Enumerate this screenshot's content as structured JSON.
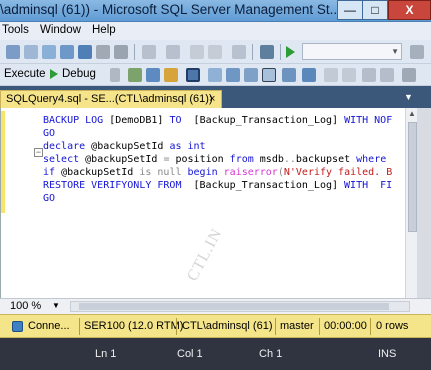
{
  "window": {
    "title": "\\adminsql (61)) - Microsoft SQL Server Management St...",
    "min_glyph": "—",
    "max_glyph": "□",
    "close_glyph": "X"
  },
  "menu": [
    "Tools",
    "Window",
    "Help"
  ],
  "toolbar2": {
    "execute_label": "Execute",
    "debug_label": "Debug",
    "execute_icon": "exclamation-icon",
    "debug_icon": "play-icon"
  },
  "tab": {
    "label": "SQLQuery4.sql - SE...(CTL\\adminsql (61))",
    "close_glyph": "×",
    "menu_glyph": "▼"
  },
  "editor": {
    "lines": [
      {
        "segments": [
          {
            "t": "BACKUP LOG ",
            "c": "kw"
          },
          {
            "t": "[DemoDB1] ",
            "c": ""
          },
          {
            "t": "TO  ",
            "c": "kw"
          },
          {
            "t": "[Backup_Transaction_Log] ",
            "c": ""
          },
          {
            "t": "WITH NOF",
            "c": "kw"
          }
        ]
      },
      {
        "segments": [
          {
            "t": "GO",
            "c": "kw"
          }
        ]
      },
      {
        "segments": [
          {
            "t": "declare ",
            "c": "kw"
          },
          {
            "t": "@backupSetId ",
            "c": ""
          },
          {
            "t": "as int",
            "c": "kw"
          }
        ]
      },
      {
        "segments": [
          {
            "t": "select ",
            "c": "kw"
          },
          {
            "t": "@backupSetId ",
            "c": ""
          },
          {
            "t": "= ",
            "c": "gray"
          },
          {
            "t": "position ",
            "c": ""
          },
          {
            "t": "from ",
            "c": "kw"
          },
          {
            "t": "msdb",
            "c": ""
          },
          {
            "t": "..",
            "c": "gray"
          },
          {
            "t": "backupset ",
            "c": ""
          },
          {
            "t": "where",
            "c": "kw"
          }
        ]
      },
      {
        "segments": [
          {
            "t": "if ",
            "c": "kw"
          },
          {
            "t": "@backupSetId ",
            "c": ""
          },
          {
            "t": "is null ",
            "c": "gray"
          },
          {
            "t": "begin ",
            "c": "kw"
          },
          {
            "t": "raiserror",
            "c": "fn"
          },
          {
            "t": "(",
            "c": "gray"
          },
          {
            "t": "N'Verify failed. B",
            "c": "str"
          }
        ]
      },
      {
        "segments": [
          {
            "t": "RESTORE VERIFYONLY FROM  ",
            "c": "kw"
          },
          {
            "t": "[Backup_Transaction_Log] ",
            "c": ""
          },
          {
            "t": "WITH  FI",
            "c": "kw"
          }
        ]
      },
      {
        "segments": [
          {
            "t": "GO",
            "c": "kw"
          }
        ]
      }
    ],
    "watermark": "CTL.IN"
  },
  "zoom": {
    "value": "100 %",
    "arrow": "▼"
  },
  "query_status": {
    "connection": "Conne...",
    "server": "SER100 (12.0 RTM)",
    "user": "CTL\\adminsql (61)",
    "database": "master",
    "elapsed": "00:00:00",
    "rows": "0 rows"
  },
  "app_status": {
    "line": "Ln 1",
    "col": "Col 1",
    "ch": "Ch 1",
    "mode": "INS"
  },
  "colors": {
    "keyword": "#1515d6",
    "string": "#c21b1b",
    "function": "#d43ad4",
    "status_bar": "#f5e58a",
    "app_status": "#2f3440"
  }
}
